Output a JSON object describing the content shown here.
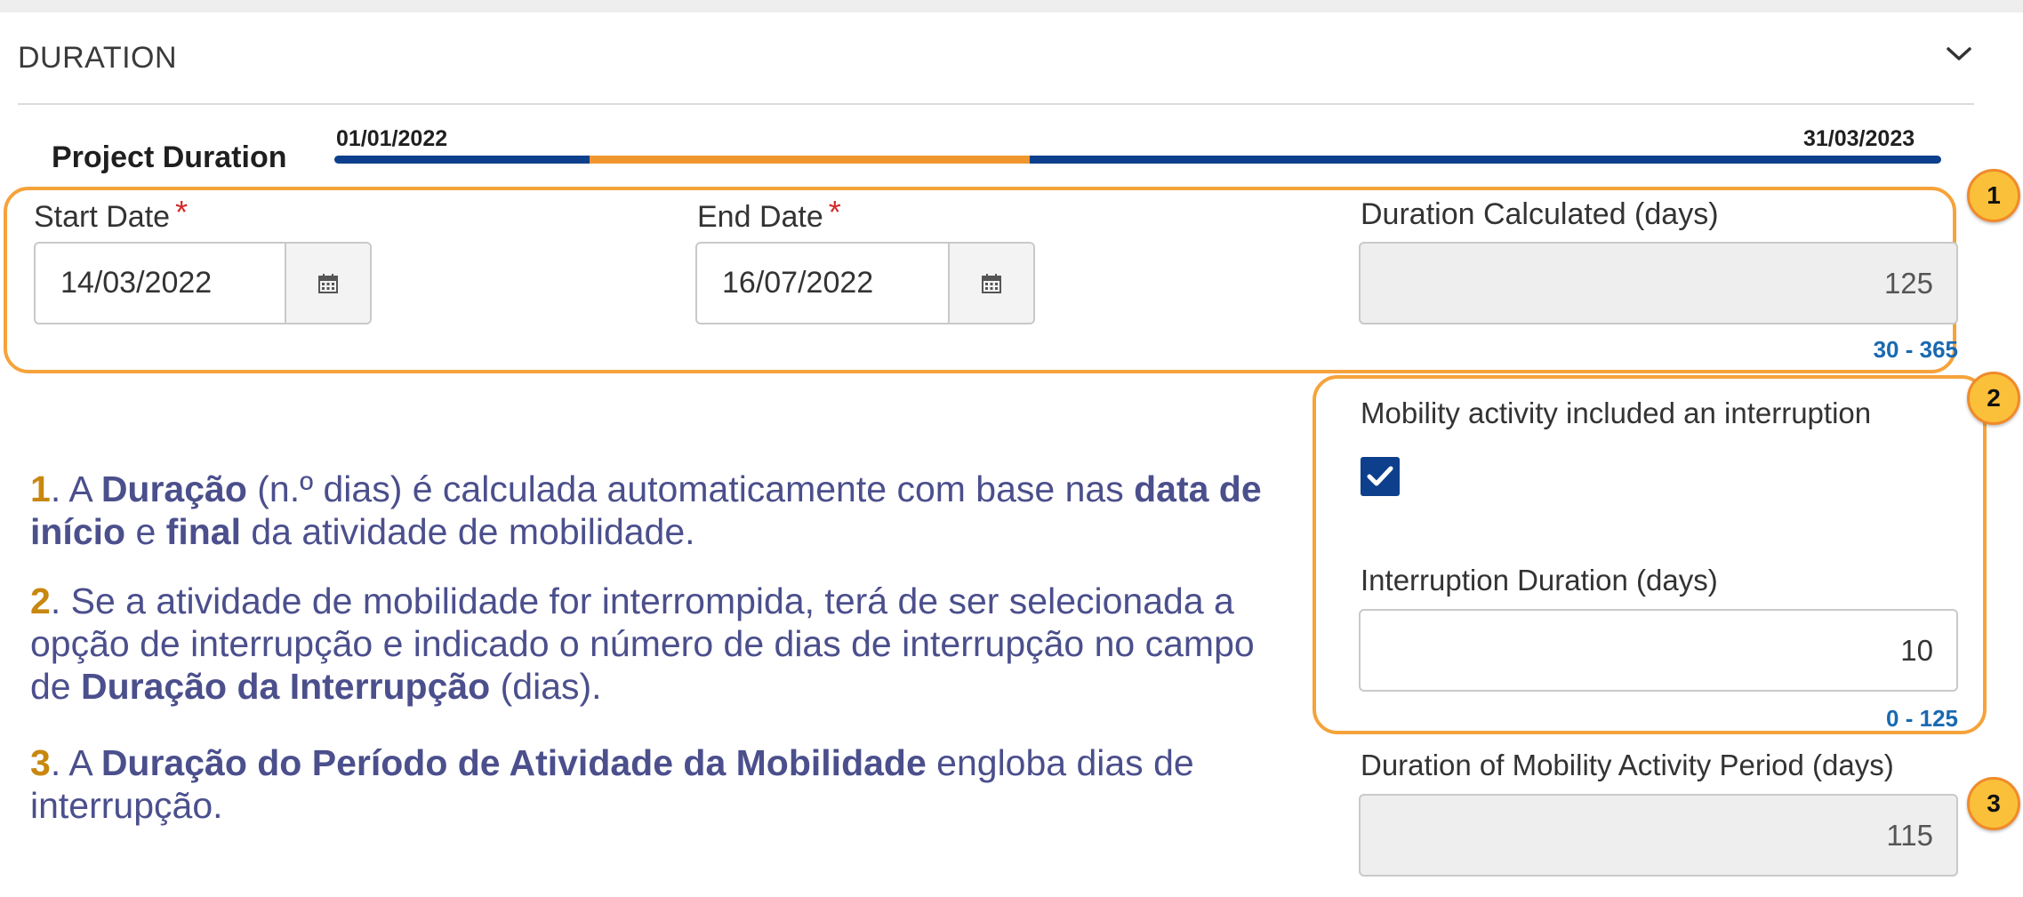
{
  "section": {
    "title": "DURATION",
    "collapse_icon": "chevron-down-icon"
  },
  "project": {
    "label": "Project Duration",
    "timeline_start": "01/01/2022",
    "timeline_end": "31/03/2023",
    "bar_colors": {
      "base": "#0e3f8c",
      "highlight": "#f0962e"
    }
  },
  "fields": {
    "start_date": {
      "label": "Start Date",
      "value": "14/03/2022",
      "required_mark": "*"
    },
    "end_date": {
      "label": "End Date",
      "value": "16/07/2022",
      "required_mark": "*"
    },
    "duration_calculated": {
      "label": "Duration Calculated (days)",
      "value": "125",
      "range": "30 - 365"
    },
    "interruption": {
      "label": "Mobility activity included an interruption",
      "checked": true
    },
    "interruption_duration": {
      "label": "Interruption Duration (days)",
      "value": "10",
      "range": "0 - 125"
    },
    "mobility_period": {
      "label": "Duration of Mobility Activity Period (days)",
      "value": "115"
    }
  },
  "badges": [
    "1",
    "2",
    "3"
  ],
  "explanations": [
    {
      "num": "1",
      "parts": [
        ". A ",
        "Duração",
        " (n.º dias) é calculada automaticamente com base nas ",
        "data de início",
        " e ",
        "final",
        " da atividade de mobilidade."
      ]
    },
    {
      "num": "2",
      "parts": [
        ". Se a atividade de mobilidade for interrompida, terá de ser selecionada a opção de interrupção e indicado o número de dias de interrupção no  campo de ",
        "Duração da Interrupção",
        " (dias)."
      ]
    },
    {
      "num": "3",
      "parts": [
        ". A ",
        "Duração do Período de Atividade da Mobilidade",
        " engloba dias de interrupção."
      ]
    }
  ],
  "colors": {
    "accent_orange": "#f5a33b",
    "badge_fill": "#fbc03a",
    "text_blue": "#4b4f8c",
    "range_blue": "#1a69b0",
    "required_red": "#d22a2a"
  }
}
